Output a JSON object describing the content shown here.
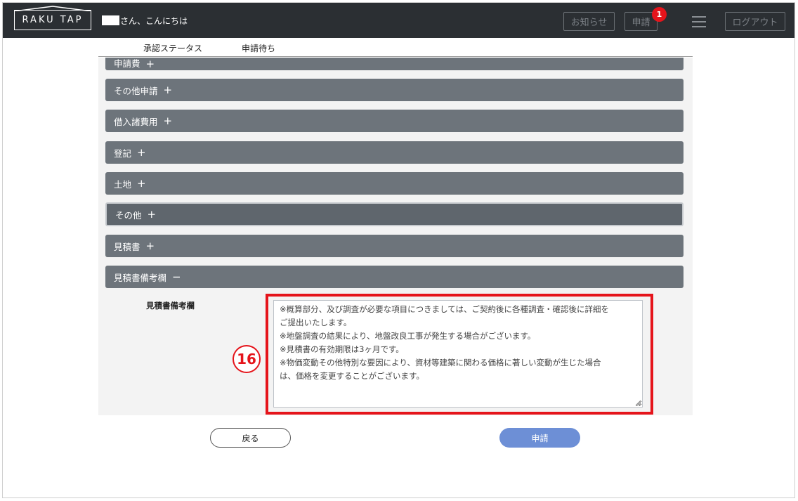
{
  "header": {
    "logo_text": "RAKU TAP",
    "greeting": "さん、こんにちは",
    "notice_label": "お知らせ",
    "apply_label": "申請",
    "apply_badge": "1",
    "logout_label": "ログアウト"
  },
  "status": {
    "label": "承認ステータス",
    "value": "申請待ち"
  },
  "accordion": [
    {
      "label": "申請費",
      "sign": "+"
    },
    {
      "label": "その他申請",
      "sign": "+"
    },
    {
      "label": "借入諸費用",
      "sign": "+"
    },
    {
      "label": "登記",
      "sign": "+"
    },
    {
      "label": "土地",
      "sign": "+"
    },
    {
      "label": "その他",
      "sign": "+"
    },
    {
      "label": "見積書",
      "sign": "+"
    },
    {
      "label": "見積書備考欄",
      "sign": "−"
    }
  ],
  "remarks": {
    "label": "見積書備考欄",
    "text": "※概算部分、及び調査が必要な項目につきましては、ご契約後に各種調査・確認後に詳細を\nご提出いたします。\n※地盤調査の結果により、地盤改良工事が発生する場合がございます。\n※見積書の有効期限は3ヶ月です。\n※物価変動その他特別な要因により、資材等建築に関わる価格に著しい変動が生じた場合\nは、価格を変更することがございます。",
    "annotation_number": "16"
  },
  "footer": {
    "back_label": "戻る",
    "submit_label": "申請"
  },
  "colors": {
    "header_bg": "#2b2f33",
    "accordion_bg": "#6d747b",
    "highlight": "#e5141b",
    "submit_bg": "#6d8fd6"
  }
}
